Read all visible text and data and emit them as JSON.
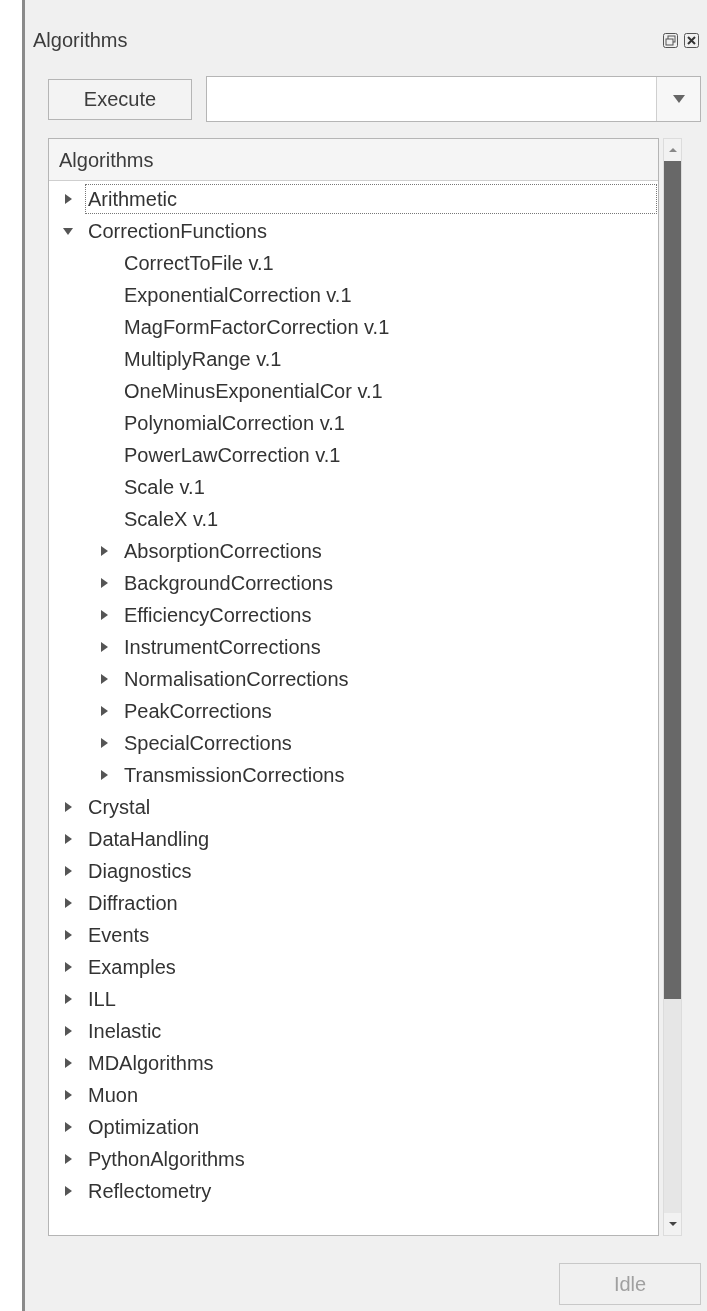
{
  "panel": {
    "title": "Algorithms"
  },
  "toolbar": {
    "execute_button": "Execute"
  },
  "tree": {
    "header": "Algorithms",
    "items": [
      {
        "label": "Arithmetic",
        "expanded": false,
        "focused": true
      },
      {
        "label": "CorrectionFunctions",
        "expanded": true,
        "focused": false,
        "children": [
          {
            "label": "CorrectToFile v.1",
            "kind": "leaf",
            "focused": false
          },
          {
            "label": "ExponentialCorrection v.1",
            "kind": "leaf",
            "focused": false
          },
          {
            "label": "MagFormFactorCorrection v.1",
            "kind": "leaf",
            "focused": false
          },
          {
            "label": "MultiplyRange v.1",
            "kind": "leaf",
            "focused": false
          },
          {
            "label": "OneMinusExponentialCor v.1",
            "kind": "leaf",
            "focused": false
          },
          {
            "label": "PolynomialCorrection v.1",
            "kind": "leaf",
            "focused": false
          },
          {
            "label": "PowerLawCorrection v.1",
            "kind": "leaf",
            "focused": false
          },
          {
            "label": "Scale v.1",
            "kind": "leaf",
            "focused": false
          },
          {
            "label": "ScaleX v.1",
            "kind": "leaf",
            "focused": false
          },
          {
            "label": "AbsorptionCorrections",
            "expanded": false,
            "focused": false
          },
          {
            "label": "BackgroundCorrections",
            "expanded": false,
            "focused": false
          },
          {
            "label": "EfficiencyCorrections",
            "expanded": false,
            "focused": false
          },
          {
            "label": "InstrumentCorrections",
            "expanded": false,
            "focused": false
          },
          {
            "label": "NormalisationCorrections",
            "expanded": false,
            "focused": false
          },
          {
            "label": "PeakCorrections",
            "expanded": false,
            "focused": false
          },
          {
            "label": "SpecialCorrections",
            "expanded": false,
            "focused": false
          },
          {
            "label": "TransmissionCorrections",
            "expanded": false,
            "focused": false
          }
        ]
      },
      {
        "label": "Crystal",
        "expanded": false,
        "focused": false
      },
      {
        "label": "DataHandling",
        "expanded": false,
        "focused": false
      },
      {
        "label": "Diagnostics",
        "expanded": false,
        "focused": false
      },
      {
        "label": "Diffraction",
        "expanded": false,
        "focused": false
      },
      {
        "label": "Events",
        "expanded": false,
        "focused": false
      },
      {
        "label": "Examples",
        "expanded": false,
        "focused": false
      },
      {
        "label": "ILL",
        "expanded": false,
        "focused": false
      },
      {
        "label": "Inelastic",
        "expanded": false,
        "focused": false
      },
      {
        "label": "MDAlgorithms",
        "expanded": false,
        "focused": false
      },
      {
        "label": "Muon",
        "expanded": false,
        "focused": false
      },
      {
        "label": "Optimization",
        "expanded": false,
        "focused": false
      },
      {
        "label": "PythonAlgorithms",
        "expanded": false,
        "focused": false
      },
      {
        "label": "Reflectometry",
        "expanded": false,
        "focused": false
      }
    ]
  },
  "status_button": {
    "label": "Idle",
    "disabled": true
  }
}
